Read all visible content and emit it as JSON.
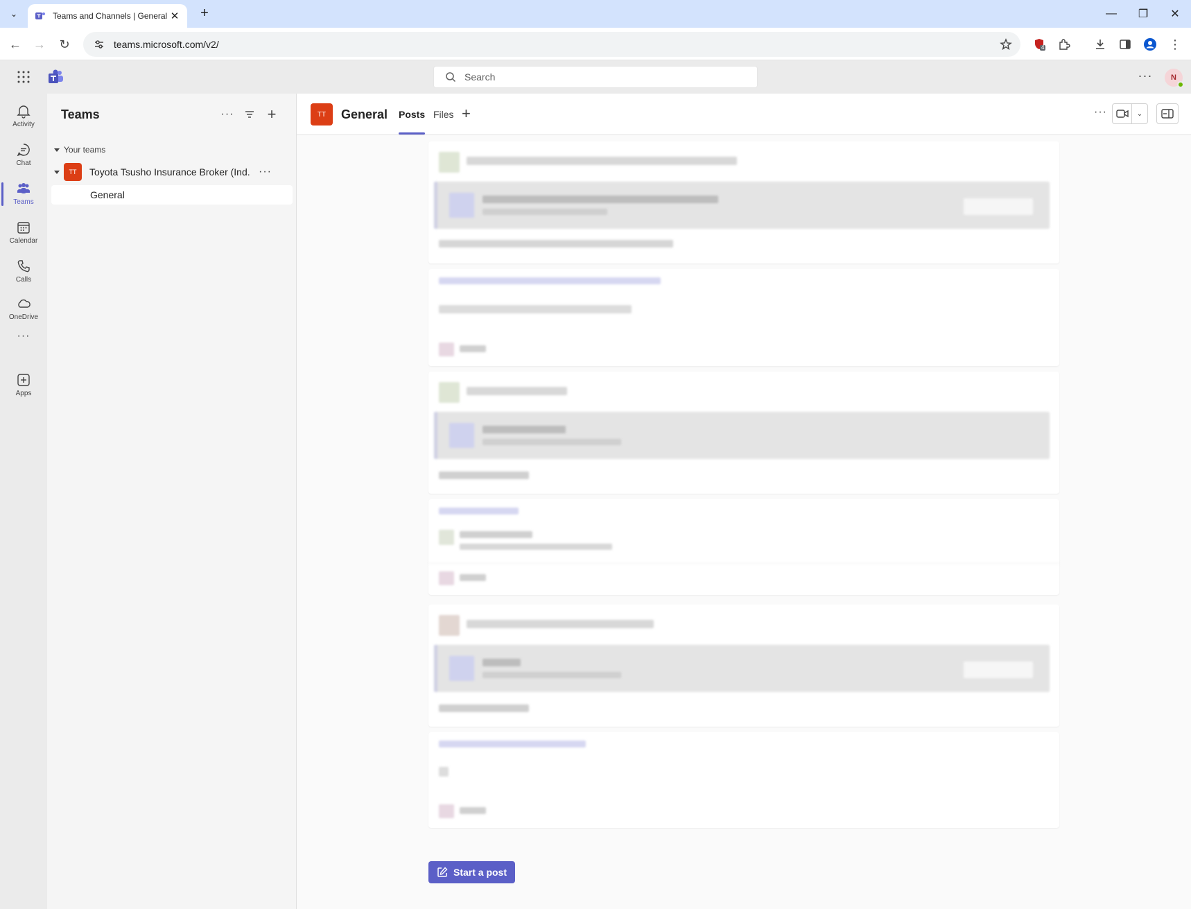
{
  "browser": {
    "tab_title": "Teams and Channels | General |",
    "url": "teams.microsoft.com/v2/",
    "extension_badge": "4"
  },
  "app": {
    "search_placeholder": "Search",
    "avatar_initial": "N"
  },
  "rail": [
    {
      "label": "Activity",
      "icon": "bell-icon"
    },
    {
      "label": "Chat",
      "icon": "chat-icon"
    },
    {
      "label": "Teams",
      "icon": "teams-icon"
    },
    {
      "label": "Calendar",
      "icon": "calendar-icon"
    },
    {
      "label": "Calls",
      "icon": "phone-icon"
    },
    {
      "label": "OneDrive",
      "icon": "cloud-icon"
    },
    {
      "label": "Apps",
      "icon": "apps-add-icon"
    }
  ],
  "teams_pane": {
    "title": "Teams",
    "section": "Your teams",
    "team_initials": "TT",
    "team_name": "Toyota Tsusho Insurance Broker (Ind...",
    "channel": "General"
  },
  "channel": {
    "initials": "TT",
    "name": "General",
    "tabs": [
      "Posts",
      "Files"
    ],
    "active_tab": "Posts"
  },
  "feed": {
    "start_post_label": "Start a post"
  },
  "colors": {
    "brand": "#5b5fc7",
    "team_tile": "#dc3e15"
  }
}
